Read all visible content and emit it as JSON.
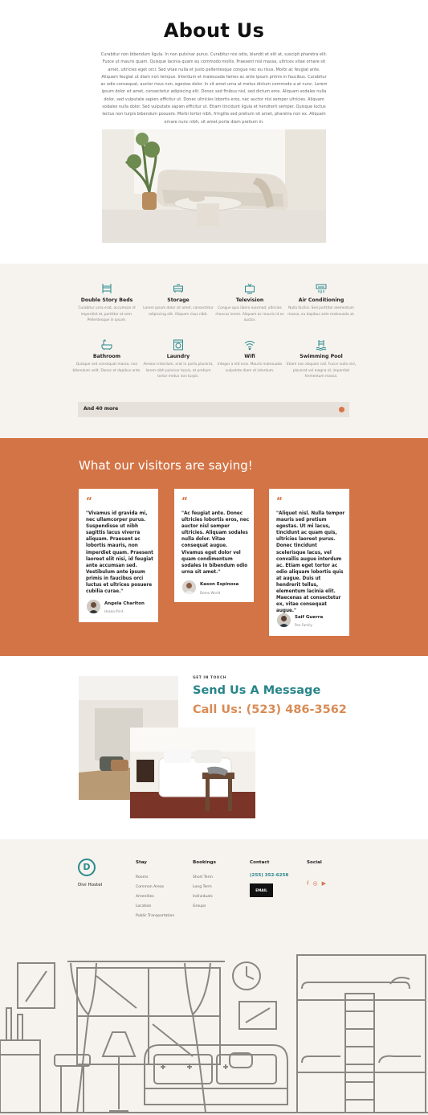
{
  "about": {
    "title": "About Us",
    "body": "Curabitur non bibendum ligula. In non pulvinar purus. Curabitur nisi odio, blandit et elit at, suscipit pharetra elit. Fusce ut mauris quam. Quisque lacinia quam eu commodo mollis. Praesent nisl massa, ultrices vitae ornare sit amet, ultricies eget orci. Sed vitae nulla et justo pellentesque congue nec eu risus. Morbi ac feugiat ante. Aliquam feugiat ut diam non tempus. Interdum et malesuada fames ac ante ipsum primis in faucibus. Curabitur ac odio consequat, auctor risus non, egestas dolor. In sit amet urna at metus dictum commodo a at nunc. Lorem ipsum dolor sit amet, consectetur adipiscing elit. Donec sed finibus nisl, sed dictum eros. Aliquam sodales nulla dolor, sed vulputate sapien efficitur ut. Donec ultricies lobortis eros, nec auctor nisl semper ultricies. Aliquam sodales nulla dolor. Sed vulputate sapien efficitur ut. Etiam tincidunt ligula et hendrerit semper. Quisque luctus lectus non turpis bibendum posuere. Morbi tortor nibh, fringilla sed pretium sit amet, pharetra non ex. Aliquam ornare nunc nibh, sit amet porta diam pretium in."
  },
  "amenities": {
    "items": [
      {
        "icon": "bunk-bed-icon",
        "title": "Double Story Beds",
        "desc": "Curabitur urna erat, accumsan id imperdiet et, porttitor at sem. Pellentesque in ipsum."
      },
      {
        "icon": "storage-icon",
        "title": "Storage",
        "desc": "Lorem ipsum dolor sit amet, consectetur adipiscing elit. Aliquam risus nibh."
      },
      {
        "icon": "television-icon",
        "title": "Television",
        "desc": "Congue quis libero euismod, ultricies rhoncus lorem. Aliquam ac mauris id ex auctor."
      },
      {
        "icon": "air-conditioning-icon",
        "title": "Air Conditioning",
        "desc": "Nulla facilisi. Sed porttitor elementum massa, eu dapibus ante malesuada at."
      },
      {
        "icon": "bathtub-icon",
        "title": "Bathroom",
        "desc": "Quisque sed consequat massa, non bibendum velit. Donec et dapibus ante."
      },
      {
        "icon": "laundry-icon",
        "title": "Laundry",
        "desc": "Aenean interdum, erat in porta placerat, lorem nibh pulvinar turpis, at pretium tortor metus non turpis."
      },
      {
        "icon": "wifi-icon",
        "title": "Wifi",
        "desc": "Integer a elit eros. Mauris malesuada vulputate diam ut interdum."
      },
      {
        "icon": "swimming-pool-icon",
        "title": "Swimming Pool",
        "desc": "Etiam non aliquam nisl. Fusce nulla nisl, placerat vel magna id, imperdiet fermentum massa."
      }
    ],
    "more_label": "And 40 more"
  },
  "testimonials": {
    "title": "What our visitors are saying!",
    "quote_mark": "“",
    "cards": [
      {
        "text": "\"Vivamus id gravida mi, nec ullamcorper purus. Suspendisse ut nibh sagittis lacus viverra aliquam. Praesent ac lobortis mauris, non imperdiet quam. Praesent laoreet elit nisi, id feugiat ante accumsan sed. Vestibulum ante ipsum primis in faucibus orci luctus et ultrices posuere cubilia curae.\"",
        "name": "Angela Charlton",
        "company": "Hosea Print"
      },
      {
        "text": "\"Ac feugiat ante. Donec ultricies lobortis eros, nec auctor nisl semper ultricies. Aliquam sodales nulla dolor. Vitae consequat augue. Vivamus eget dolor vel quam condimentum sodales in bibendum odio urna sit amet.\"",
        "name": "Kason Espinosa",
        "company": "Demo World"
      },
      {
        "text": "\"Aliquet nisl. Nulla tempor mauris sed pretium egestas. Ut mi lacus, tincidunt ac quam quis, ultricies laoreet purus. Donec tincidunt scelerisque lacus, vel convallis augue interdum ac. Etiam eget tortor ac odio aliquam lobortis quis at augue. Duis ut hendrerit tellus, elementum lacinia elit. Maecenas at consectetur ex, vitae consequat augue.\"",
        "name": "Saif Guerra",
        "company": "Pon Family"
      }
    ]
  },
  "contact": {
    "kicker": "GET IN TOUCH",
    "heading": "Send Us A Message",
    "phone": "Call Us: (523) 486-3562"
  },
  "footer": {
    "brand": "Divi Hostel",
    "logo_letter": "D",
    "stay": {
      "title": "Stay",
      "links": [
        "Rooms",
        "Common Areas",
        "Amenities",
        "Location",
        "Public Transportation"
      ]
    },
    "bookings": {
      "title": "Bookings",
      "links": [
        "Short Term",
        "Long Term",
        "Individuals",
        "Groups"
      ]
    },
    "contact": {
      "title": "Contact",
      "phone": "(255) 352-6258",
      "email_label": "EMAIL"
    },
    "social": {
      "title": "Social",
      "icons": [
        "facebook-icon",
        "instagram-icon",
        "youtube-icon"
      ]
    }
  },
  "colors": {
    "accent_orange": "#d37446",
    "teal": "#27858a",
    "cream": "#f6f3ee",
    "phone_orange": "#d98b55"
  }
}
